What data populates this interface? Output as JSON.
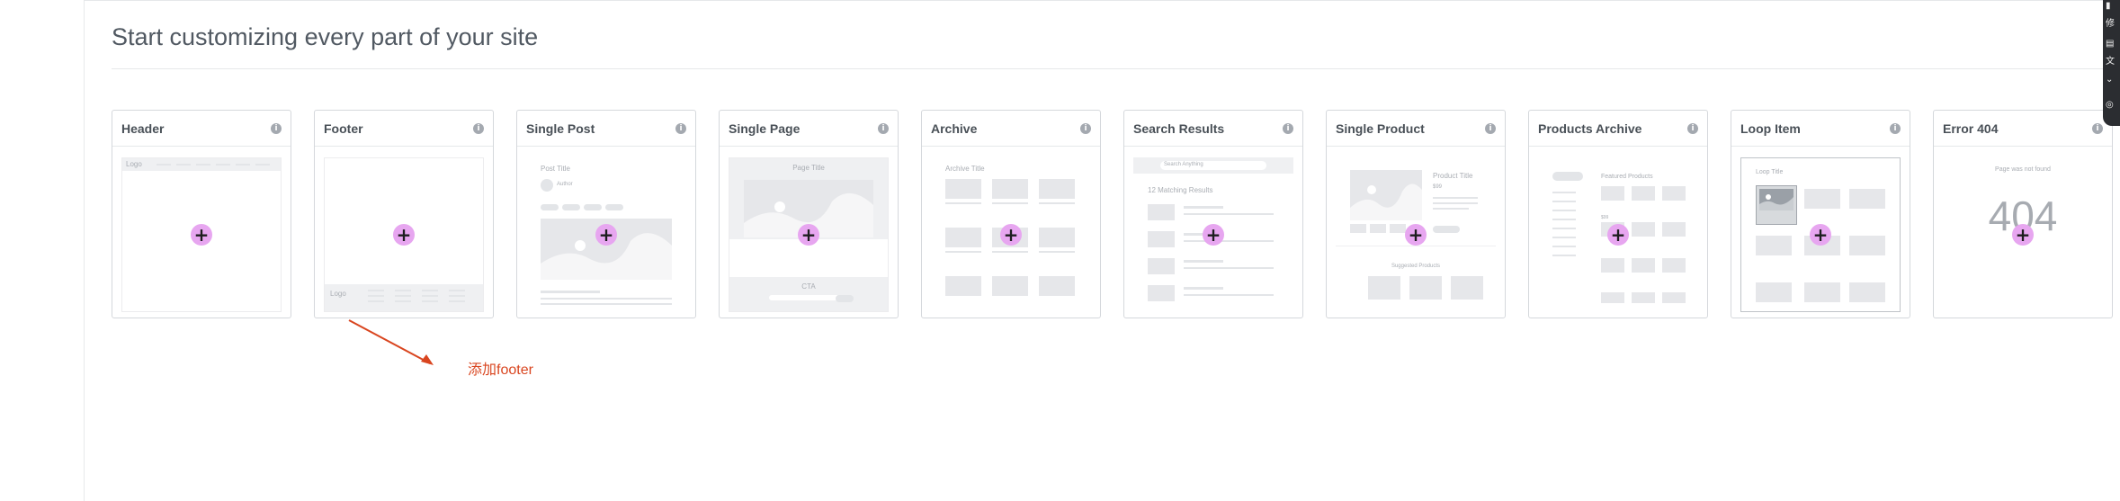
{
  "page": {
    "title": "Start customizing every part of your site"
  },
  "cards": [
    {
      "title": "Header",
      "preview_texts": [
        "Logo"
      ]
    },
    {
      "title": "Footer",
      "preview_texts": [
        "Logo"
      ]
    },
    {
      "title": "Single Post",
      "preview_texts": [
        "Post Title",
        "Author"
      ]
    },
    {
      "title": "Single Page",
      "preview_texts": [
        "Page Title",
        "CTA"
      ]
    },
    {
      "title": "Archive",
      "preview_texts": [
        "Archive Title"
      ]
    },
    {
      "title": "Search Results",
      "preview_texts": [
        "Search Anything",
        "12 Matching Results"
      ]
    },
    {
      "title": "Single Product",
      "preview_texts": [
        "Product Title",
        "$99",
        "Suggested Products"
      ]
    },
    {
      "title": "Products Archive",
      "preview_texts": [
        "Featured Products",
        "$99"
      ]
    },
    {
      "title": "Loop Item",
      "preview_texts": [
        "Loop Title"
      ]
    },
    {
      "title": "Error 404",
      "preview_texts": [
        "Page was not found",
        "404"
      ]
    }
  ],
  "icons": {
    "info": "info-icon",
    "add": "plus-icon"
  },
  "annotation": {
    "text": "添加footer",
    "color": "#d9451f"
  },
  "right_panel": {
    "items": [
      "修",
      "文"
    ]
  },
  "colors": {
    "add_button": "#e7a6f0",
    "placeholder": "#e3e5e8"
  }
}
